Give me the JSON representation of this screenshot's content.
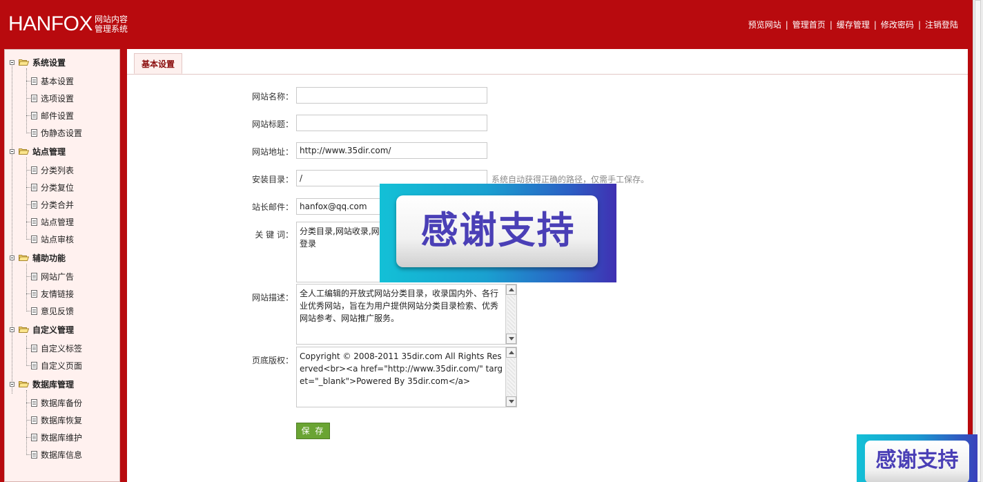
{
  "colors": {
    "header_bg": "#b80a0e",
    "sidebar_bg": "#fff1ef",
    "save_button": "#6aa433",
    "tab_text": "#8a0c0c",
    "ad_text": "#4a3fb6"
  },
  "header": {
    "logo_main": "HANFOX",
    "logo_sub_line1": "网站内容",
    "logo_sub_line2": "管理系统",
    "nav": [
      "预览网站",
      "管理首页",
      "缓存管理",
      "修改密码",
      "注销登陆"
    ],
    "nav_separator": "|"
  },
  "sidebar": {
    "groups": [
      {
        "label": "系统设置",
        "items": [
          "基本设置",
          "选项设置",
          "邮件设置",
          "伪静态设置"
        ]
      },
      {
        "label": "站点管理",
        "items": [
          "分类列表",
          "分类复位",
          "分类合并",
          "站点管理",
          "站点审核"
        ]
      },
      {
        "label": "辅助功能",
        "items": [
          "网站广告",
          "友情链接",
          "意见反馈"
        ]
      },
      {
        "label": "自定义管理",
        "items": [
          "自定义标签",
          "自定义页面"
        ]
      },
      {
        "label": "数据库管理",
        "items": [
          "数据库备份",
          "数据库恢复",
          "数据库维护",
          "数据库信息"
        ]
      }
    ]
  },
  "main": {
    "tab_label": "基本设置",
    "form": {
      "site_name_label": "网站名称：",
      "site_name_value": "",
      "site_title_label": "网站标题：",
      "site_title_value": "",
      "site_url_label": "网站地址：",
      "site_url_value": "http://www.35dir.com/",
      "install_dir_label": "安装目录：",
      "install_dir_value": "/",
      "install_dir_hint": "系统自动获得正确的路径，仅需手工保存。",
      "admin_email_label": "站长邮件：",
      "admin_email_value": "hanfox@qq.com",
      "keywords_label": "关 键 词：",
      "keywords_value": "分类目录,网站收录,网\n登录",
      "description_label": "网站描述：",
      "description_value": "全人工编辑的开放式网站分类目录，收录国内外、各行业优秀网站，旨在为用户提供网站分类目录检索、优秀网站参考、网站推广服务。",
      "copyright_label": "页底版权：",
      "copyright_value": "Copyright © 2008-2011 35dir.com All Rights Reserved<br><a href=\"http://www.35dir.com/\" target=\"_blank\">Powered By 35dir.com</a>",
      "save_label": "保 存"
    }
  },
  "overlays": {
    "ad_big_text": "感谢支持",
    "ad_small_text": "感谢支持"
  }
}
